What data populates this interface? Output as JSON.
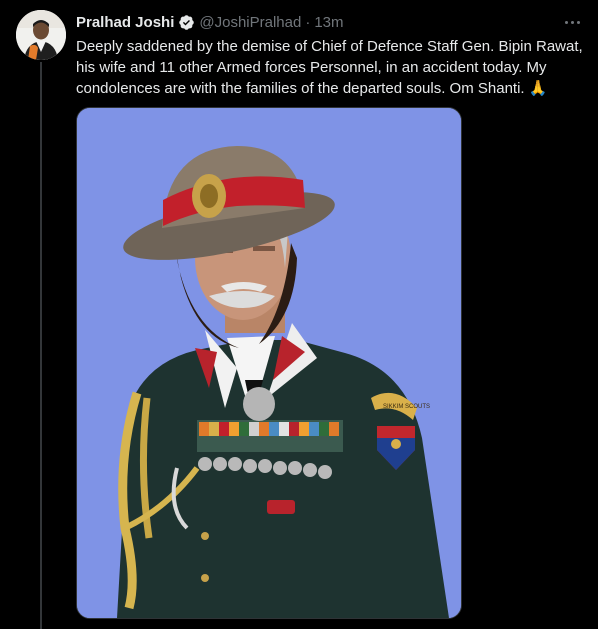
{
  "tweet": {
    "display_name": "Pralhad Joshi",
    "handle": "@JoshiPralhad",
    "separator": "·",
    "time": "13m",
    "text": "Deeply saddened by the demise of Chief of Defence Staff Gen. Bipin Rawat, his wife and 11 other Armed forces Personnel, in an accident today. My condolences are with the families of the departed souls. Om Shanti. 🙏"
  },
  "media": {
    "badge_text": "SIKKIM SCOUTS",
    "background_color": "#7f93e6"
  },
  "icons": {
    "verified": "verified-badge-icon",
    "more": "more-options-icon"
  }
}
